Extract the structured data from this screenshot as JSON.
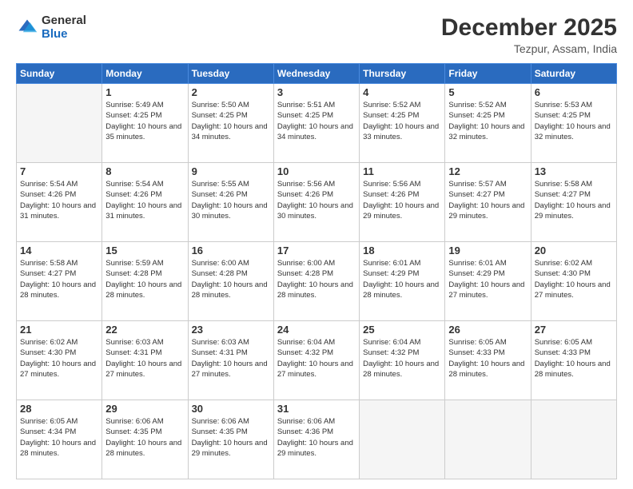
{
  "logo": {
    "general": "General",
    "blue": "Blue"
  },
  "header": {
    "title": "December 2025",
    "location": "Tezpur, Assam, India"
  },
  "days_of_week": [
    "Sunday",
    "Monday",
    "Tuesday",
    "Wednesday",
    "Thursday",
    "Friday",
    "Saturday"
  ],
  "weeks": [
    [
      {
        "day": "",
        "sunrise": "",
        "sunset": "",
        "daylight": ""
      },
      {
        "day": "1",
        "sunrise": "Sunrise: 5:49 AM",
        "sunset": "Sunset: 4:25 PM",
        "daylight": "Daylight: 10 hours and 35 minutes."
      },
      {
        "day": "2",
        "sunrise": "Sunrise: 5:50 AM",
        "sunset": "Sunset: 4:25 PM",
        "daylight": "Daylight: 10 hours and 34 minutes."
      },
      {
        "day": "3",
        "sunrise": "Sunrise: 5:51 AM",
        "sunset": "Sunset: 4:25 PM",
        "daylight": "Daylight: 10 hours and 34 minutes."
      },
      {
        "day": "4",
        "sunrise": "Sunrise: 5:52 AM",
        "sunset": "Sunset: 4:25 PM",
        "daylight": "Daylight: 10 hours and 33 minutes."
      },
      {
        "day": "5",
        "sunrise": "Sunrise: 5:52 AM",
        "sunset": "Sunset: 4:25 PM",
        "daylight": "Daylight: 10 hours and 32 minutes."
      },
      {
        "day": "6",
        "sunrise": "Sunrise: 5:53 AM",
        "sunset": "Sunset: 4:25 PM",
        "daylight": "Daylight: 10 hours and 32 minutes."
      }
    ],
    [
      {
        "day": "7",
        "sunrise": "Sunrise: 5:54 AM",
        "sunset": "Sunset: 4:26 PM",
        "daylight": "Daylight: 10 hours and 31 minutes."
      },
      {
        "day": "8",
        "sunrise": "Sunrise: 5:54 AM",
        "sunset": "Sunset: 4:26 PM",
        "daylight": "Daylight: 10 hours and 31 minutes."
      },
      {
        "day": "9",
        "sunrise": "Sunrise: 5:55 AM",
        "sunset": "Sunset: 4:26 PM",
        "daylight": "Daylight: 10 hours and 30 minutes."
      },
      {
        "day": "10",
        "sunrise": "Sunrise: 5:56 AM",
        "sunset": "Sunset: 4:26 PM",
        "daylight": "Daylight: 10 hours and 30 minutes."
      },
      {
        "day": "11",
        "sunrise": "Sunrise: 5:56 AM",
        "sunset": "Sunset: 4:26 PM",
        "daylight": "Daylight: 10 hours and 29 minutes."
      },
      {
        "day": "12",
        "sunrise": "Sunrise: 5:57 AM",
        "sunset": "Sunset: 4:27 PM",
        "daylight": "Daylight: 10 hours and 29 minutes."
      },
      {
        "day": "13",
        "sunrise": "Sunrise: 5:58 AM",
        "sunset": "Sunset: 4:27 PM",
        "daylight": "Daylight: 10 hours and 29 minutes."
      }
    ],
    [
      {
        "day": "14",
        "sunrise": "Sunrise: 5:58 AM",
        "sunset": "Sunset: 4:27 PM",
        "daylight": "Daylight: 10 hours and 28 minutes."
      },
      {
        "day": "15",
        "sunrise": "Sunrise: 5:59 AM",
        "sunset": "Sunset: 4:28 PM",
        "daylight": "Daylight: 10 hours and 28 minutes."
      },
      {
        "day": "16",
        "sunrise": "Sunrise: 6:00 AM",
        "sunset": "Sunset: 4:28 PM",
        "daylight": "Daylight: 10 hours and 28 minutes."
      },
      {
        "day": "17",
        "sunrise": "Sunrise: 6:00 AM",
        "sunset": "Sunset: 4:28 PM",
        "daylight": "Daylight: 10 hours and 28 minutes."
      },
      {
        "day": "18",
        "sunrise": "Sunrise: 6:01 AM",
        "sunset": "Sunset: 4:29 PM",
        "daylight": "Daylight: 10 hours and 28 minutes."
      },
      {
        "day": "19",
        "sunrise": "Sunrise: 6:01 AM",
        "sunset": "Sunset: 4:29 PM",
        "daylight": "Daylight: 10 hours and 27 minutes."
      },
      {
        "day": "20",
        "sunrise": "Sunrise: 6:02 AM",
        "sunset": "Sunset: 4:30 PM",
        "daylight": "Daylight: 10 hours and 27 minutes."
      }
    ],
    [
      {
        "day": "21",
        "sunrise": "Sunrise: 6:02 AM",
        "sunset": "Sunset: 4:30 PM",
        "daylight": "Daylight: 10 hours and 27 minutes."
      },
      {
        "day": "22",
        "sunrise": "Sunrise: 6:03 AM",
        "sunset": "Sunset: 4:31 PM",
        "daylight": "Daylight: 10 hours and 27 minutes."
      },
      {
        "day": "23",
        "sunrise": "Sunrise: 6:03 AM",
        "sunset": "Sunset: 4:31 PM",
        "daylight": "Daylight: 10 hours and 27 minutes."
      },
      {
        "day": "24",
        "sunrise": "Sunrise: 6:04 AM",
        "sunset": "Sunset: 4:32 PM",
        "daylight": "Daylight: 10 hours and 27 minutes."
      },
      {
        "day": "25",
        "sunrise": "Sunrise: 6:04 AM",
        "sunset": "Sunset: 4:32 PM",
        "daylight": "Daylight: 10 hours and 28 minutes."
      },
      {
        "day": "26",
        "sunrise": "Sunrise: 6:05 AM",
        "sunset": "Sunset: 4:33 PM",
        "daylight": "Daylight: 10 hours and 28 minutes."
      },
      {
        "day": "27",
        "sunrise": "Sunrise: 6:05 AM",
        "sunset": "Sunset: 4:33 PM",
        "daylight": "Daylight: 10 hours and 28 minutes."
      }
    ],
    [
      {
        "day": "28",
        "sunrise": "Sunrise: 6:05 AM",
        "sunset": "Sunset: 4:34 PM",
        "daylight": "Daylight: 10 hours and 28 minutes."
      },
      {
        "day": "29",
        "sunrise": "Sunrise: 6:06 AM",
        "sunset": "Sunset: 4:35 PM",
        "daylight": "Daylight: 10 hours and 28 minutes."
      },
      {
        "day": "30",
        "sunrise": "Sunrise: 6:06 AM",
        "sunset": "Sunset: 4:35 PM",
        "daylight": "Daylight: 10 hours and 29 minutes."
      },
      {
        "day": "31",
        "sunrise": "Sunrise: 6:06 AM",
        "sunset": "Sunset: 4:36 PM",
        "daylight": "Daylight: 10 hours and 29 minutes."
      },
      {
        "day": "",
        "sunrise": "",
        "sunset": "",
        "daylight": ""
      },
      {
        "day": "",
        "sunrise": "",
        "sunset": "",
        "daylight": ""
      },
      {
        "day": "",
        "sunrise": "",
        "sunset": "",
        "daylight": ""
      }
    ]
  ]
}
